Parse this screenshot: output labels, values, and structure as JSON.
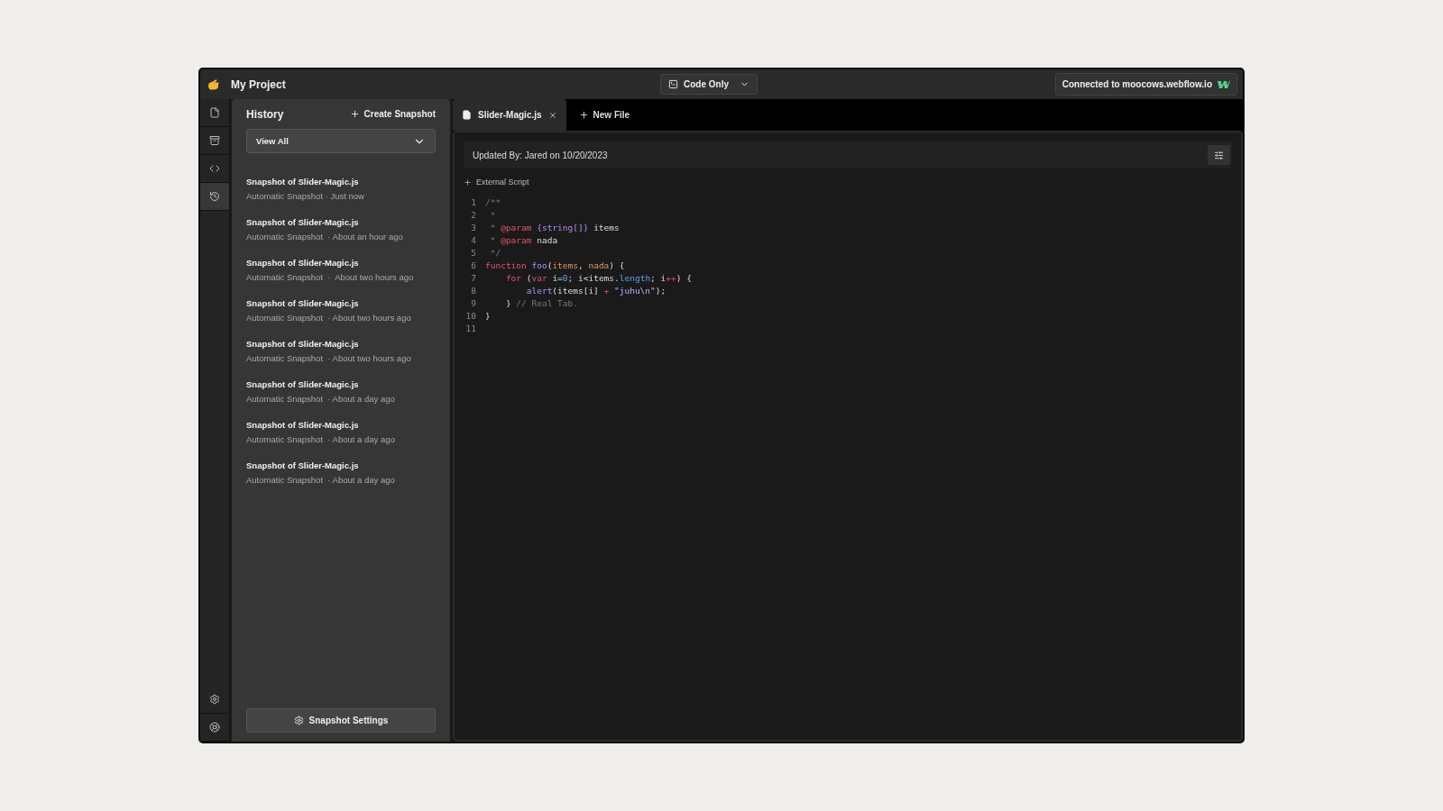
{
  "window": {
    "title": "My Project"
  },
  "view_mode": {
    "label": "Code Only"
  },
  "connection": {
    "label": "Connected to moocows.webflow.io"
  },
  "rail": {
    "items": [
      {
        "kind": "file",
        "selected": false
      },
      {
        "kind": "tray",
        "selected": false
      },
      {
        "kind": "code",
        "selected": false
      },
      {
        "kind": "history",
        "selected": true
      }
    ],
    "bottom_items": [
      {
        "kind": "settings"
      },
      {
        "kind": "help"
      }
    ]
  },
  "history": {
    "title": "History",
    "create_button": "Create Snapshot",
    "filter": "View All",
    "items": [
      {
        "title": "Snapshot of Slider-Magic.js",
        "subtitle": "Automatic Snapshot · Just now"
      },
      {
        "title": "Snapshot of Slider-Magic.js",
        "subtitle": "Automatic Snapshot  · About an hour ago"
      },
      {
        "title": "Snapshot of Slider-Magic.js",
        "subtitle": "Automatic Snapshot  ·  About two hours ago"
      },
      {
        "title": "Snapshot of Slider-Magic.js",
        "subtitle": "Automatic Snapshot  · About two hours ago"
      },
      {
        "title": "Snapshot of Slider-Magic.js",
        "subtitle": "Automatic Snapshot  · About two hours ago"
      },
      {
        "title": "Snapshot of Slider-Magic.js",
        "subtitle": "Automatic Snapshot  · About a day ago"
      },
      {
        "title": "Snapshot of Slider-Magic.js",
        "subtitle": "Automatic Snapshot  · About a day ago"
      },
      {
        "title": "Snapshot of Slider-Magic.js",
        "subtitle": "Automatic Snapshot  · About a day ago"
      }
    ],
    "settings_button": "Snapshot Settings"
  },
  "tabs": [
    {
      "label": "Slider-Magic.js",
      "selected": true
    }
  ],
  "new_file_button": "New File",
  "editor": {
    "updated_by": "Updated By: Jared on 10/20/2023",
    "section": "External Script",
    "lines": [
      {
        "number": "1",
        "tokens": [
          {
            "text": "/**",
            "kind": "comment"
          }
        ]
      },
      {
        "number": "2",
        "tokens": [
          {
            "text": " *",
            "kind": "comment"
          }
        ]
      },
      {
        "number": "3",
        "tokens": [
          {
            "text": " * ",
            "kind": "comment"
          },
          {
            "text": "@param",
            "kind": "tag"
          },
          {
            "text": " {string[]}",
            "kind": "type"
          },
          {
            "text": " items",
            "kind": "plain"
          }
        ]
      },
      {
        "number": "4",
        "tokens": [
          {
            "text": " * ",
            "kind": "comment"
          },
          {
            "text": "@param",
            "kind": "tag"
          },
          {
            "text": " nada",
            "kind": "plain"
          }
        ]
      },
      {
        "number": "5",
        "tokens": [
          {
            "text": " */",
            "kind": "comment"
          }
        ]
      },
      {
        "number": "6",
        "tokens": [
          {
            "text": "function",
            "kind": "keyword"
          },
          {
            "text": " foo",
            "kind": "function"
          },
          {
            "text": "(",
            "kind": "plain"
          },
          {
            "text": "items",
            "kind": "param"
          },
          {
            "text": ", ",
            "kind": "plain"
          },
          {
            "text": "nada",
            "kind": "param"
          },
          {
            "text": ") {",
            "kind": "plain"
          }
        ]
      },
      {
        "number": "7",
        "tokens": [
          {
            "text": "    for",
            "kind": "keyword"
          },
          {
            "text": " (",
            "kind": "plain"
          },
          {
            "text": "var",
            "kind": "keyword"
          },
          {
            "text": " i=",
            "kind": "plain"
          },
          {
            "text": "0",
            "kind": "number"
          },
          {
            "text": "; i<items.",
            "kind": "plain"
          },
          {
            "text": "length",
            "kind": "property"
          },
          {
            "text": "; i",
            "kind": "plain"
          },
          {
            "text": "++",
            "kind": "operator"
          },
          {
            "text": ") {",
            "kind": "plain"
          }
        ]
      },
      {
        "number": "8",
        "tokens": [
          {
            "text": "        alert",
            "kind": "function"
          },
          {
            "text": "(items[i] ",
            "kind": "plain"
          },
          {
            "text": "+",
            "kind": "operator"
          },
          {
            "text": " \"juhu\\n\"",
            "kind": "string"
          },
          {
            "text": ");",
            "kind": "plain"
          }
        ]
      },
      {
        "number": "9",
        "tokens": [
          {
            "text": "    } ",
            "kind": "plain"
          },
          {
            "text": "// Real Tab.",
            "kind": "comment"
          }
        ]
      },
      {
        "number": "10",
        "tokens": [
          {
            "text": "}",
            "kind": "plain"
          }
        ]
      },
      {
        "number": "11"
      }
    ]
  }
}
